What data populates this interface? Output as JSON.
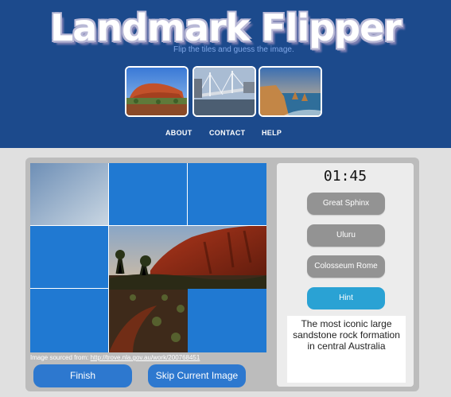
{
  "header": {
    "title": "Landmark Flipper",
    "subtitle": "Flip the tiles and guess the image.",
    "thumbnails": [
      "uluru-thumbnail",
      "bridge-thumbnail",
      "coastline-thumbnail"
    ],
    "nav": {
      "about": "ABOUT",
      "contact": "CONTACT",
      "help": "HELP"
    }
  },
  "game": {
    "timer": "01:45",
    "answers": [
      "Great Sphinx",
      "Uluru",
      "Colosseum Rome"
    ],
    "hint_label": "Hint",
    "hint_text": "The most iconic large sandstone rock formation in central Australia",
    "source_label": "Image sourced from:",
    "source_url": "http://trove.nla.gov.au/work/200768451",
    "finish_label": "Finish",
    "skip_label": "Skip Current Image"
  },
  "colors": {
    "header_bg": "#1c4a8c",
    "tile_blue": "#2079d2",
    "answer_gray": "#939393",
    "hint_blue": "#2aa2d4",
    "button_blue": "#2d78cf"
  }
}
